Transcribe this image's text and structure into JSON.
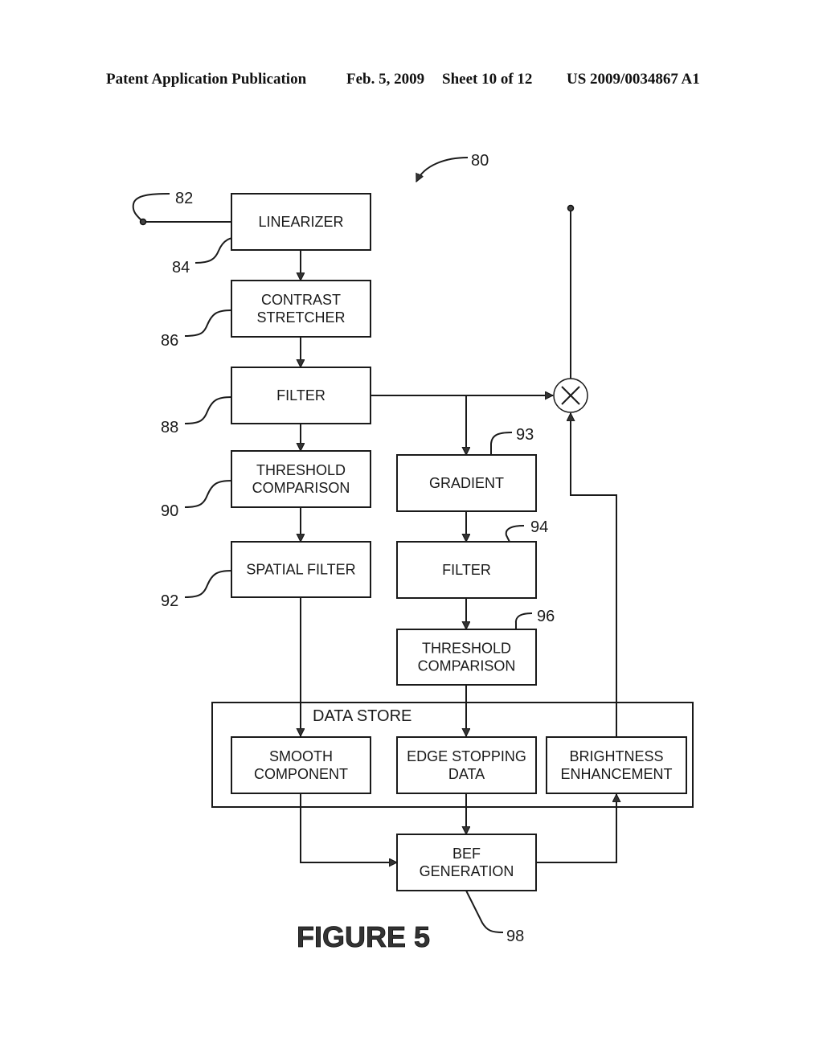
{
  "header": {
    "publication": "Patent Application Publication",
    "date": "Feb. 5, 2009",
    "sheet": "Sheet 10 of 12",
    "number": "US 2009/0034867 A1"
  },
  "figure": {
    "title": "FIGURE 5",
    "ref_overall": "80",
    "ref_input": "82"
  },
  "blocks": {
    "linearizer": {
      "lines": [
        "LINEARIZER"
      ],
      "ref": "84"
    },
    "contrast_stretcher": {
      "lines": [
        "CONTRAST",
        "STRETCHER"
      ],
      "ref": "86"
    },
    "filter_main": {
      "lines": [
        "FILTER"
      ],
      "ref": "88"
    },
    "threshold_left": {
      "lines": [
        "THRESHOLD",
        "COMPARISON"
      ],
      "ref": "90"
    },
    "spatial_filter": {
      "lines": [
        "SPATIAL FILTER"
      ],
      "ref": "92"
    },
    "gradient": {
      "lines": [
        "GRADIENT"
      ],
      "ref": "93"
    },
    "filter_right": {
      "lines": [
        "FILTER"
      ],
      "ref": "94"
    },
    "threshold_right": {
      "lines": [
        "THRESHOLD",
        "COMPARISON"
      ],
      "ref": "96"
    },
    "smooth_component": {
      "lines": [
        "SMOOTH",
        "COMPONENT"
      ]
    },
    "edge_stopping": {
      "lines": [
        "EDGE STOPPING",
        "DATA"
      ]
    },
    "brightness": {
      "lines": [
        "BRIGHTNESS",
        "ENHANCEMENT"
      ]
    },
    "bef_generation": {
      "lines": [
        "BEF",
        "GENERATION"
      ],
      "ref": "98"
    }
  },
  "data_store": {
    "label": "DATA STORE"
  },
  "multiplier": {
    "symbol": "multiply"
  },
  "colors": {
    "ink": "#1a1a1a",
    "background": "#ffffff"
  }
}
